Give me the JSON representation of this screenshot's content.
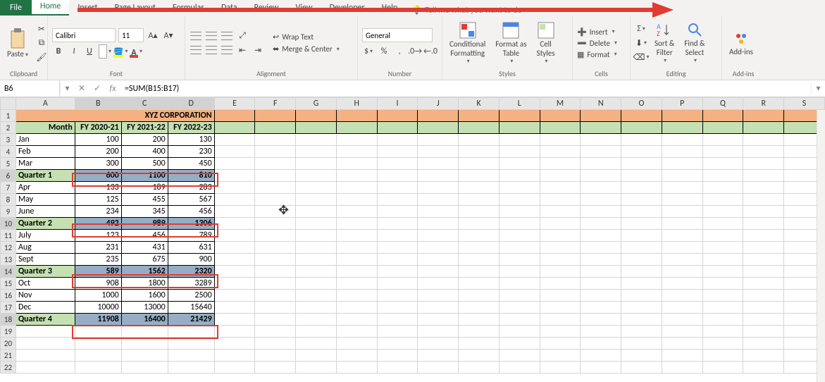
{
  "tabs": {
    "file": "File",
    "home": "Home",
    "insert": "Insert",
    "pagelayout": "Page Layout",
    "formulas": "Formulas",
    "data": "Data",
    "review": "Review",
    "view": "View",
    "developer": "Developer",
    "help": "Help",
    "tellme": "Tell me what you want to do"
  },
  "ribbon": {
    "clipboard": {
      "paste": "Paste",
      "label": "Clipboard"
    },
    "font": {
      "name": "Calibri",
      "size": "11",
      "label": "Font"
    },
    "alignment": {
      "wrap": "Wrap Text",
      "merge": "Merge & Center",
      "label": "Alignment"
    },
    "number": {
      "format": "General",
      "label": "Number"
    },
    "styles": {
      "cond": "Conditional",
      "cond2": "Formatting",
      "fas": "Format as",
      "fas2": "Table",
      "cs": "Cell",
      "cs2": "Styles",
      "label": "Styles"
    },
    "cells": {
      "insert": "Insert",
      "delete": "Delete",
      "format": "Format",
      "label": "Cells"
    },
    "editing": {
      "sort": "Sort &",
      "sort2": "Filter",
      "find": "Find &",
      "find2": "Select",
      "label": "Editing"
    },
    "addins": {
      "btn": "Add-ins",
      "label": "Add-ins"
    }
  },
  "fbar": {
    "name": "B6",
    "formula": "=SUM(B15:B17)"
  },
  "cols": [
    "A",
    "B",
    "C",
    "D",
    "E",
    "F",
    "G",
    "H",
    "I",
    "J",
    "K",
    "L",
    "M",
    "N",
    "O",
    "P",
    "Q",
    "R",
    "S"
  ],
  "rows": [
    1,
    2,
    3,
    4,
    5,
    6,
    7,
    8,
    9,
    10,
    11,
    12,
    13,
    14,
    15,
    16,
    17,
    18,
    19,
    20,
    21,
    22
  ],
  "title": "XYZ CORPORATION",
  "headers": {
    "a": "Month",
    "b": "FY 2020-21",
    "c": "FY 2021-22",
    "d": "FY 2022-23"
  },
  "d": {
    "r3": {
      "a": "Jan",
      "b": "100",
      "c": "200",
      "d": "130"
    },
    "r4": {
      "a": "Feb",
      "b": "200",
      "c": "400",
      "d": "230"
    },
    "r5": {
      "a": "Mar",
      "b": "300",
      "c": "500",
      "d": "450"
    },
    "r6": {
      "a": "Quarter 1",
      "b": "600",
      "c": "1100",
      "d": "810"
    },
    "r7": {
      "a": "Apr",
      "b": "133",
      "c": "189",
      "d": "283"
    },
    "r8": {
      "a": "May",
      "b": "125",
      "c": "455",
      "d": "567"
    },
    "r9": {
      "a": "June",
      "b": "234",
      "c": "345",
      "d": "456"
    },
    "r10": {
      "a": "Quarter 2",
      "b": "492",
      "c": "989",
      "d": "1306"
    },
    "r11": {
      "a": "July",
      "b": "123",
      "c": "456",
      "d": "789"
    },
    "r12": {
      "a": "Aug",
      "b": "231",
      "c": "431",
      "d": "631"
    },
    "r13": {
      "a": "Sept",
      "b": "235",
      "c": "675",
      "d": "900"
    },
    "r14": {
      "a": "Quarter 3",
      "b": "589",
      "c": "1562",
      "d": "2320"
    },
    "r15": {
      "a": "Oct",
      "b": "908",
      "c": "1800",
      "d": "3289"
    },
    "r16": {
      "a": "Nov",
      "b": "1000",
      "c": "1600",
      "d": "2500"
    },
    "r17": {
      "a": "Dec",
      "b": "10000",
      "c": "13000",
      "d": "15640"
    },
    "r18": {
      "a": "Quarter 4",
      "b": "11908",
      "c": "16400",
      "d": "21429"
    }
  }
}
